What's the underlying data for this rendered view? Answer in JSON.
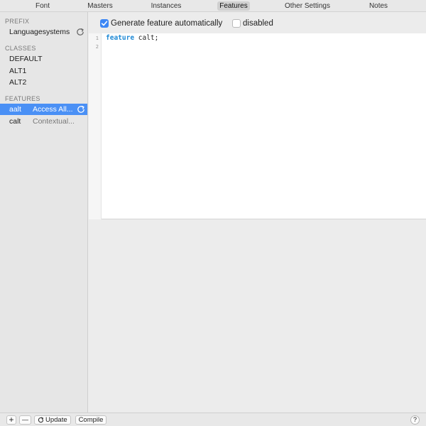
{
  "tabs": [
    {
      "label": "Font"
    },
    {
      "label": "Masters"
    },
    {
      "label": "Instances"
    },
    {
      "label": "Features",
      "active": true
    },
    {
      "label": "Other Settings"
    },
    {
      "label": "Notes"
    }
  ],
  "sidebar": {
    "prefix_header": "PREFIX",
    "prefix_items": [
      {
        "label": "Languagesystems"
      }
    ],
    "classes_header": "CLASSES",
    "classes_items": [
      {
        "label": "DEFAULT"
      },
      {
        "label": "ALT1"
      },
      {
        "label": "ALT2"
      }
    ],
    "features_header": "FEATURES",
    "features_items": [
      {
        "tag": "aalt",
        "description": "Access All...",
        "selected": true
      },
      {
        "tag": "calt",
        "description": "Contextual...",
        "selected": false
      }
    ]
  },
  "toolbar": {
    "generate_label": "Generate feature automatically",
    "generate_checked": true,
    "disabled_label": "disabled",
    "disabled_checked": false
  },
  "editor": {
    "line_numbers": [
      "1",
      "2"
    ],
    "keyword": "feature",
    "code_rest": " calt;"
  },
  "bottombar": {
    "add_glyph": "+",
    "remove_glyph": "—",
    "update_label": "Update",
    "compile_label": "Compile",
    "help_label": "?"
  },
  "colors": {
    "selection": "#4a90f5",
    "checkbox_checked": "#3d87f5",
    "keyword": "#1f8ad6"
  }
}
